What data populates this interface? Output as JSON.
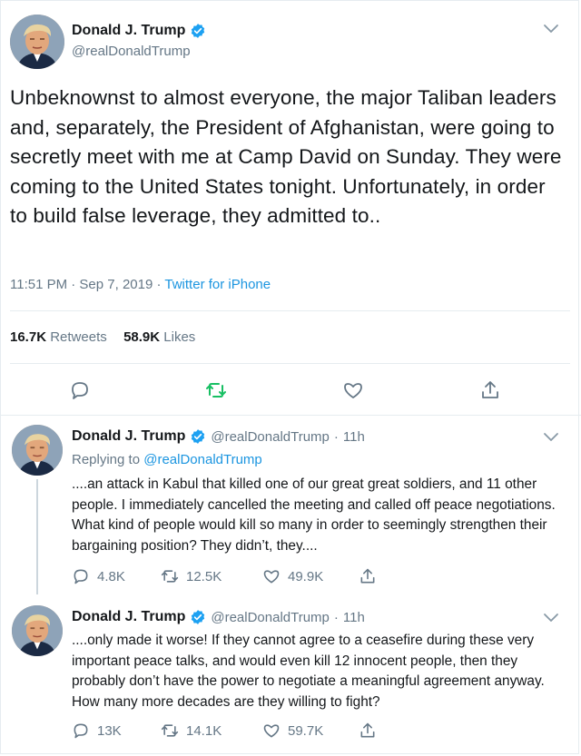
{
  "main_tweet": {
    "author_name": "Donald J. Trump",
    "author_handle": "@realDonaldTrump",
    "text": "Unbeknownst to almost everyone, the major Taliban leaders and, separately, the President of Afghanistan, were going to secretly meet with me at Camp David on Sunday. They were coming to the United States tonight. Unfortunately, in order to build false leverage, they admitted to..",
    "time": "11:51 PM · Sep 7, 2019 · ",
    "source": "Twitter for iPhone",
    "retweets_count": "16.7K",
    "retweets_label": "Retweets",
    "likes_count": "58.9K",
    "likes_label": "Likes",
    "icons": [
      "reply-icon",
      "retweet-icon",
      "like-icon",
      "share-icon"
    ],
    "retweet_color": "#17bf63"
  },
  "replies": [
    {
      "author_name": "Donald J. Trump",
      "author_handle": "@realDonaldTrump",
      "age": "11h",
      "replying_prefix": "Replying to ",
      "replying_to": "@realDonaldTrump",
      "text": "....an attack in Kabul that killed one of our great great soldiers, and 11 other people. I immediately cancelled the meeting and called off peace negotiations. What kind of people would kill so many in order to seemingly strengthen their bargaining position? They didn’t, they....",
      "reply_count": "4.8K",
      "retweet_count": "12.5K",
      "like_count": "49.9K"
    },
    {
      "author_name": "Donald J. Trump",
      "author_handle": "@realDonaldTrump",
      "age": "11h",
      "text": "....only made it worse! If they cannot agree to a ceasefire during these very important peace talks, and would even kill 12 innocent people, then they probably don’t have the power to negotiate a meaningful agreement anyway. How many more decades are they willing to fight?",
      "reply_count": "13K",
      "retweet_count": "14.1K",
      "like_count": "59.7K"
    }
  ],
  "colors": {
    "link": "#1b95e0",
    "verified": "#1da1f2",
    "muted": "#657786",
    "divider": "#e6ecf0"
  }
}
